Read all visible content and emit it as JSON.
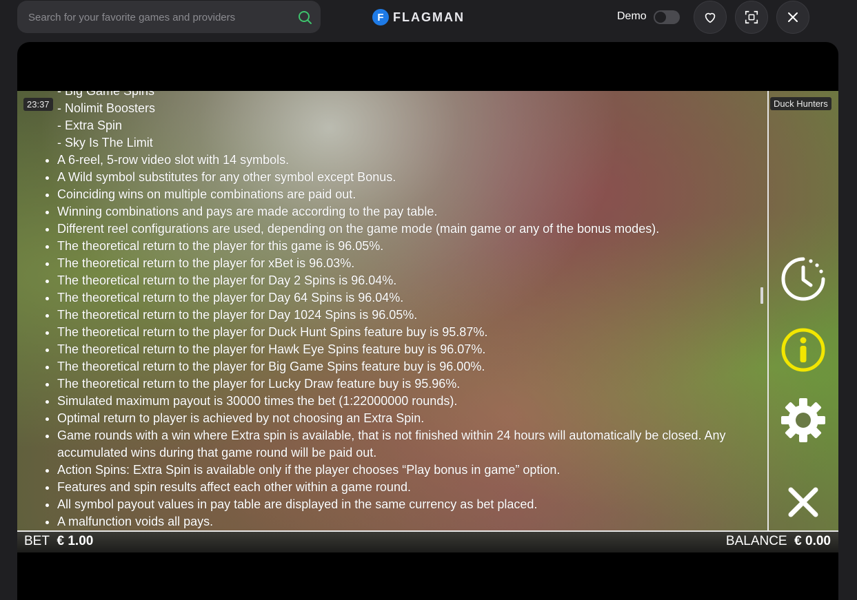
{
  "search": {
    "placeholder": "Search for your favorite games and providers"
  },
  "logo": {
    "badge": "F",
    "text": "FLAGMAN"
  },
  "demo": {
    "label": "Demo",
    "enabled": false
  },
  "game": {
    "time": "23:37",
    "title": "Duck Hunters",
    "sub_items": [
      "- Big Game Spins",
      "- Nolimit Boosters",
      "- Extra Spin",
      "- Sky Is The Limit"
    ],
    "rules": [
      "A 6-reel, 5-row video slot with 14 symbols.",
      "A Wild symbol substitutes for any other symbol except Bonus.",
      "Coinciding wins on multiple combinations are paid out.",
      "Winning combinations and pays are made according to the pay table.",
      "Different reel configurations are used, depending on the game mode (main game or any of the bonus modes).",
      "The theoretical return to the player for this game is 96.05%.",
      "The theoretical return to the player for xBet is 96.03%.",
      "The theoretical return to the player for Day 2 Spins is 96.04%.",
      "The theoretical return to the player for Day 64 Spins is 96.04%.",
      "The theoretical return to the player for Day 1024 Spins is 96.05%.",
      "The theoretical return to the player for Duck Hunt Spins feature buy is 95.87%.",
      "The theoretical return to the player for Hawk Eye Spins feature buy is 96.07%.",
      "The theoretical return to the player for Big Game Spins feature buy is 96.00%.",
      "The theoretical return to the player for Lucky Draw feature buy is 95.96%.",
      "Simulated maximum payout is 30000 times the bet (1:22000000 rounds).",
      "Optimal return to player is achieved by not choosing an Extra Spin.",
      "Game rounds with a win where Extra spin is available, that is not finished within 24 hours will automatically be closed. Any accumulated wins during that game round will be paid out.",
      "Action Spins: Extra Spin is available only if the player chooses “Play bonus in game” option.",
      "Features and spin results affect each other within a game round.",
      "All symbol payout values in pay table are displayed in the same currency as bet placed.",
      "A malfunction voids all pays."
    ],
    "bet_label": "BET",
    "bet_value": "€ 1.00",
    "balance_label": "BALANCE",
    "balance_value": "€ 0.00",
    "info_icon_color": "#f2e600"
  }
}
